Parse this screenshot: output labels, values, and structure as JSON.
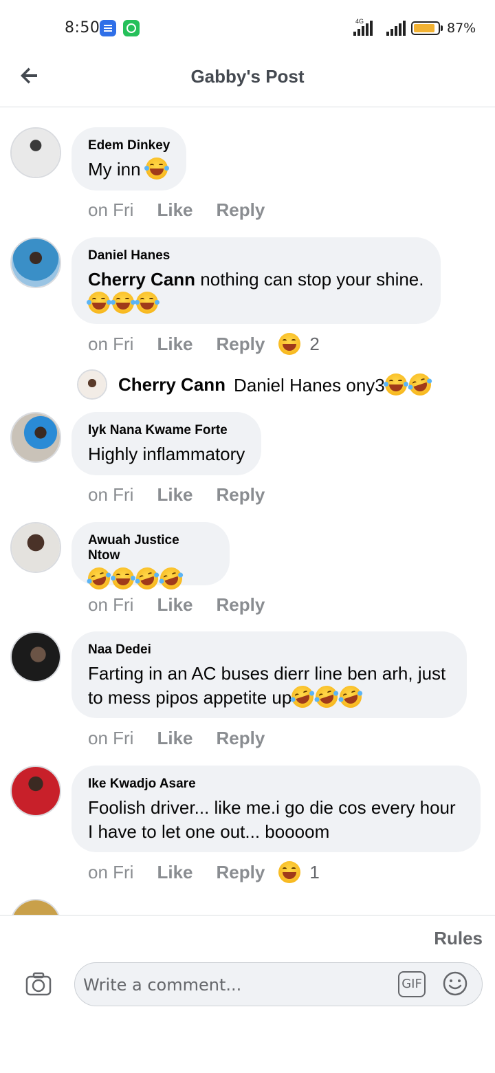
{
  "status_bar": {
    "time": "8:50",
    "network": "4G",
    "battery_percent": "87%",
    "battery_level": 0.87,
    "notification_icons": [
      "messages-icon",
      "whatsapp-icon"
    ]
  },
  "header": {
    "title": "Gabby's Post"
  },
  "comments": [
    {
      "author": "Edem Dinkey",
      "text": "My inn",
      "emojis": 1,
      "time": "on Fri",
      "like_label": "Like",
      "reply_label": "Reply"
    },
    {
      "author": "Daniel Hanes",
      "mention": "Cherry Cann",
      "text": " nothing can stop your shine.",
      "emojis": 3,
      "time": "on Fri",
      "like_label": "Like",
      "reply_label": "Reply",
      "reaction_count": "2",
      "reply": {
        "author": "Cherry Cann",
        "text": "Daniel Hanes ony3"
      }
    },
    {
      "author": "Iyk Nana Kwame Forte",
      "text": "Highly inflammatory",
      "time": "on Fri",
      "like_label": "Like",
      "reply_label": "Reply"
    },
    {
      "author": "Awuah Justice Ntow",
      "text": "",
      "emojis": 4,
      "time": "on Fri",
      "like_label": "Like",
      "reply_label": "Reply"
    },
    {
      "author": "Naa Dedei",
      "text_line1": "Farting in an AC buses dierr line ben arh, just",
      "text_line2": "to mess pipos appetite up",
      "emojis": 3,
      "time": "on Fri",
      "like_label": "Like",
      "reply_label": "Reply"
    },
    {
      "author": "Ike Kwadjo Asare",
      "text_line1": "Foolish driver... like me.i go die cos every hour",
      "text_line2": "I have to let one out... boooom",
      "time": "on Fri",
      "like_label": "Like",
      "reply_label": "Reply",
      "reaction_count": "1"
    }
  ],
  "composer": {
    "rules_label": "Rules",
    "placeholder": "Write a comment...",
    "gif_label": "GIF"
  },
  "colors": {
    "bubble_bg": "#f0f2f5",
    "meta_text": "#8a8d91",
    "header_text": "#444950",
    "battery": "#f2b233"
  }
}
